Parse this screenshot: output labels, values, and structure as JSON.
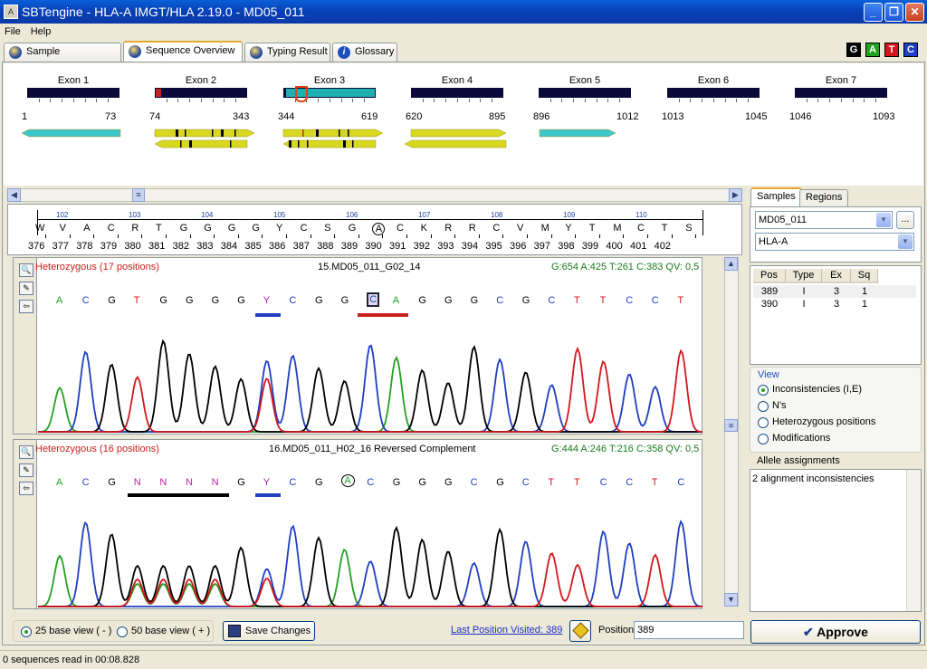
{
  "window": {
    "title": "SBTengine - HLA-A IMGT/HLA 2.19.0 - MD05_011",
    "app_icon_label": "A"
  },
  "menu": {
    "file": "File",
    "help": "Help"
  },
  "tabs": [
    {
      "label": "Sample Management"
    },
    {
      "label": "Sequence Overview"
    },
    {
      "label": "Typing Result"
    },
    {
      "label": "Glossary"
    }
  ],
  "bases_legend": [
    {
      "letter": "G",
      "bg": "#000000",
      "fg": "#ffffff"
    },
    {
      "letter": "A",
      "bg": "#21a121",
      "fg": "#ffffff"
    },
    {
      "letter": "T",
      "bg": "#d4161c",
      "fg": "#ffffff"
    },
    {
      "letter": "C",
      "bg": "#1f3fbf",
      "fg": "#ffffff"
    }
  ],
  "exons": [
    {
      "label": "Exon 1",
      "start": "1",
      "end": "73"
    },
    {
      "label": "Exon 2",
      "start": "74",
      "end": "343"
    },
    {
      "label": "Exon 3",
      "start": "344",
      "end": "619"
    },
    {
      "label": "Exon 4",
      "start": "620",
      "end": "895"
    },
    {
      "label": "Exon 5",
      "start": "896",
      "end": "1012"
    },
    {
      "label": "Exon 6",
      "start": "1013",
      "end": "1045"
    },
    {
      "label": "Exon 7",
      "start": "1046",
      "end": "1093"
    }
  ],
  "ruler": {
    "codons": [
      "102",
      "103",
      "104",
      "105",
      "106",
      "107",
      "108",
      "109",
      "110"
    ],
    "letters": [
      "W",
      "V",
      "A",
      "C",
      "R",
      "T",
      "G",
      "G",
      "G",
      "G",
      "Y",
      "C",
      "S",
      "G",
      "A",
      "C",
      "K",
      "R",
      "R",
      "C",
      "V",
      "M",
      "Y",
      "T",
      "M",
      "C",
      "T",
      "S"
    ],
    "positions": [
      "376",
      "377",
      "378",
      "379",
      "380",
      "381",
      "382",
      "383",
      "384",
      "385",
      "386",
      "387",
      "388",
      "389",
      "390",
      "391",
      "392",
      "393",
      "394",
      "395",
      "396",
      "397",
      "398",
      "399",
      "400",
      "401",
      "402"
    ]
  },
  "traces": [
    {
      "het": "Heterozygous (17 positions)",
      "name": "15.MD05_011_G02_14",
      "stats": "G:654 A:425 T:261 C:383 QV: 0,5",
      "bases": [
        "A",
        "C",
        "G",
        "T",
        "G",
        "G",
        "G",
        "G",
        "Y",
        "C",
        "G",
        "G",
        "C",
        "A",
        "G",
        "G",
        "G",
        "C",
        "G",
        "C",
        "T",
        "T",
        "C",
        "C",
        "T"
      ]
    },
    {
      "het": "Heterozygous (16 positions)",
      "name": "16.MD05_011_H02_16 Reversed Complement",
      "stats": "G:444 A:246 T:216 C:358 QV: 0,5",
      "bases": [
        "A",
        "C",
        "G",
        "N",
        "N",
        "N",
        "N",
        "G",
        "Y",
        "C",
        "G",
        "A",
        "C",
        "G",
        "G",
        "G",
        "C",
        "G",
        "C",
        "T",
        "T",
        "C",
        "C",
        "T",
        "C"
      ]
    }
  ],
  "right": {
    "tab_samples": "Samples",
    "tab_regions": "Regions",
    "sample_value": "MD05_011",
    "browse_label": "...",
    "locus_value": "HLA-A",
    "table": {
      "headers": [
        "Pos",
        "Type",
        "Ex",
        "Sq"
      ],
      "rows": [
        [
          "389",
          "I",
          "3",
          "1"
        ],
        [
          "390",
          "I",
          "3",
          "1"
        ]
      ]
    },
    "view_title": "View",
    "view_options": [
      "Inconsistencies (I,E)",
      "N's",
      "Heterozygous positions",
      "Modifications"
    ],
    "allele_title": "Allele assignments",
    "allele_text": "2 alignment inconsistencies"
  },
  "bottom": {
    "opt25": "25 base view ( - )",
    "opt50": "50 base view ( + )",
    "save": "Save Changes",
    "last_pos": "Last Position Visited: 389",
    "position_label": "Position",
    "position_value": "389",
    "approve": "Approve"
  },
  "status": "0 sequences read in 00:08.828"
}
